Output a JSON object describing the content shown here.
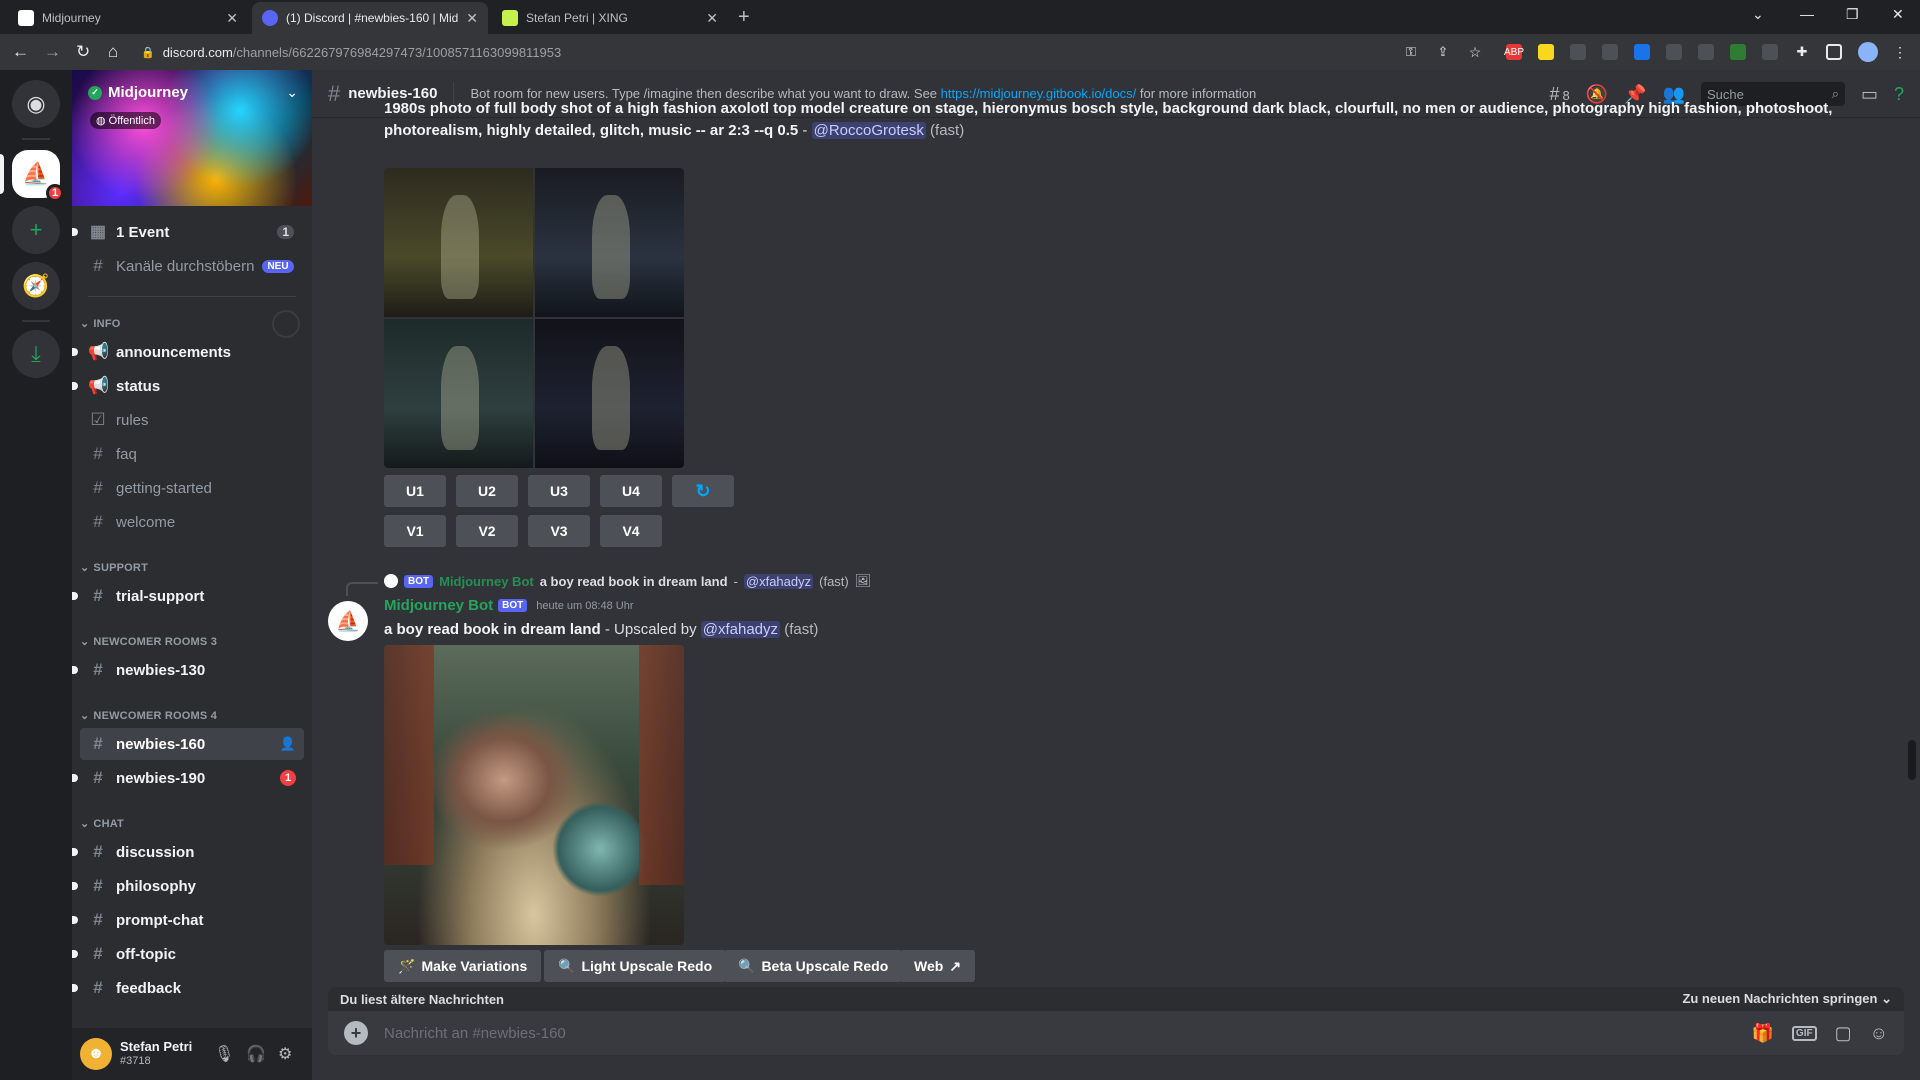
{
  "browser": {
    "tabs": [
      {
        "title": "Midjourney"
      },
      {
        "title": "(1) Discord | #newbies-160 | Mid"
      },
      {
        "title": "Stefan Petri | XING"
      }
    ],
    "url_host": "discord.com",
    "url_path": "/channels/662267976984297473/1008571163099811953"
  },
  "server": {
    "name": "Midjourney",
    "visibility": "Öffentlich"
  },
  "sidebar": {
    "top": [
      {
        "label": "1 Event",
        "count": "1"
      },
      {
        "label": "Kanäle durchstöbern",
        "badge": "NEU"
      }
    ],
    "categories": {
      "info": "INFO",
      "support": "SUPPORT",
      "nr3": "NEWCOMER ROOMS 3",
      "nr4": "NEWCOMER ROOMS 4",
      "chat": "CHAT"
    },
    "info_channels": [
      "announcements",
      "status",
      "rules",
      "faq",
      "getting-started",
      "welcome"
    ],
    "support_channels": [
      "trial-support"
    ],
    "nr3_channels": [
      "newbies-130"
    ],
    "nr4_channels": [
      "newbies-160",
      "newbies-190"
    ],
    "nr4_badge": "1",
    "chat_channels": [
      "discussion",
      "philosophy",
      "prompt-chat",
      "off-topic",
      "feedback"
    ]
  },
  "user": {
    "name": "Stefan Petri",
    "tag": "#3718"
  },
  "header": {
    "channel": "newbies-160",
    "topic_pre": "Bot room for new users. Type /imagine then describe what you want to draw. See ",
    "topic_link": "https://midjourney.gitbook.io/docs/",
    "topic_post": " for more information",
    "threads_count": "8",
    "search_placeholder": "Suche"
  },
  "messages": {
    "first": {
      "prompt": "1980s photo of full body shot of a high fashion axolotl top model creature on stage, hieronymus bosch style, background dark black, clourfull, no men or audience, photography high fashion, photoshoot, photorealism, highly detailed, glitch, music -- ar 2:3 --q 0.5",
      "separator": " - ",
      "mention": "@RoccoGrotesk",
      "mode": "(fast)",
      "buttons_u": [
        "U1",
        "U2",
        "U3",
        "U4"
      ],
      "buttons_v": [
        "V1",
        "V2",
        "V3",
        "V4"
      ]
    },
    "second": {
      "reply_author": "Midjourney Bot",
      "reply_prompt": "a boy read book in dream land",
      "reply_mention": "@xfahadyz",
      "reply_mode": "(fast)",
      "author": "Midjourney Bot",
      "bot_tag": "BOT",
      "timestamp": "heute um 08:48 Uhr",
      "prompt": "a boy read book in dream land",
      "upscaled_by": " - Upscaled by ",
      "mention": "@xfahadyz",
      "mode": "(fast)",
      "actions": [
        "Make Variations",
        "Light Upscale Redo",
        "Beta Upscale Redo",
        "Web"
      ]
    }
  },
  "composer": {
    "older_notice": "Du liest ältere Nachrichten",
    "jump_label": "Zu neuen Nachrichten springen",
    "placeholder": "Nachricht an #newbies-160"
  },
  "colors": {
    "bg": "#313338",
    "sidebar": "#2b2d31",
    "accent": "#5865f2",
    "green": "#23a55a",
    "red": "#f23f43"
  }
}
